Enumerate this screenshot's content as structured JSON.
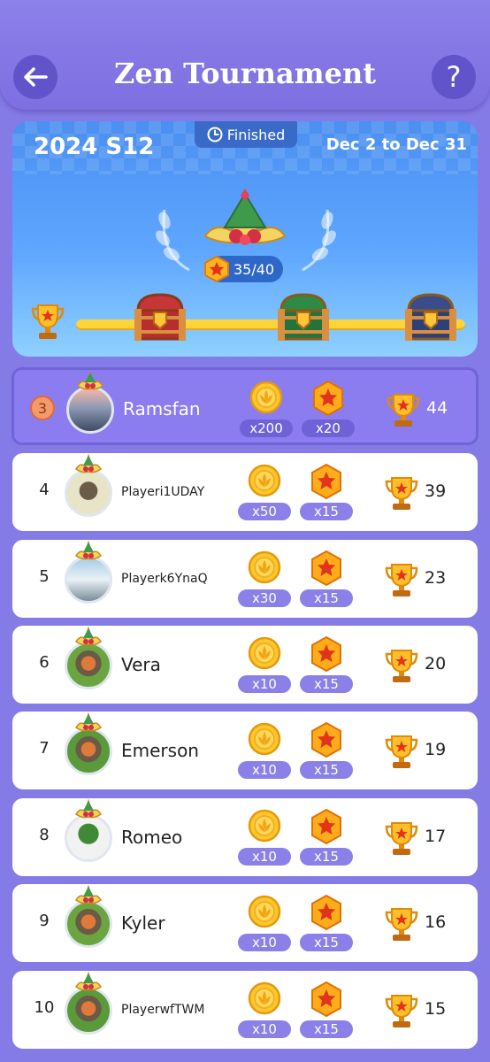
{
  "header": {
    "title": "Zen Tournament",
    "back_icon": "arrow-left-icon",
    "help_label": "?"
  },
  "banner": {
    "season": "2024 S12",
    "status": "Finished",
    "dates": "Dec 2 to Dec 31",
    "progress": "35/40",
    "progress_value": 35,
    "progress_max": 40,
    "chests": [
      "red-chest",
      "green-chest",
      "navy-chest"
    ]
  },
  "colors": {
    "accent": "#857be6",
    "highlight_row": "#8b7cf0",
    "gold": "#ffd43a"
  },
  "rows": [
    {
      "rank": "3",
      "name": "Ramsfan",
      "coins": "x200",
      "stars": "x20",
      "score": "44",
      "me": true
    },
    {
      "rank": "4",
      "name": "Playeri1UDAY",
      "coins": "x50",
      "stars": "x15",
      "score": "39"
    },
    {
      "rank": "5",
      "name": "Playerk6YnaQ",
      "coins": "x30",
      "stars": "x15",
      "score": "23"
    },
    {
      "rank": "6",
      "name": "Vera",
      "coins": "x10",
      "stars": "x15",
      "score": "20"
    },
    {
      "rank": "7",
      "name": "Emerson",
      "coins": "x10",
      "stars": "x15",
      "score": "19"
    },
    {
      "rank": "8",
      "name": "Romeo",
      "coins": "x10",
      "stars": "x15",
      "score": "17"
    },
    {
      "rank": "9",
      "name": "Kyler",
      "coins": "x10",
      "stars": "x15",
      "score": "16"
    },
    {
      "rank": "10",
      "name": "PlayerwfTWM",
      "coins": "x10",
      "stars": "x15",
      "score": "15"
    }
  ]
}
